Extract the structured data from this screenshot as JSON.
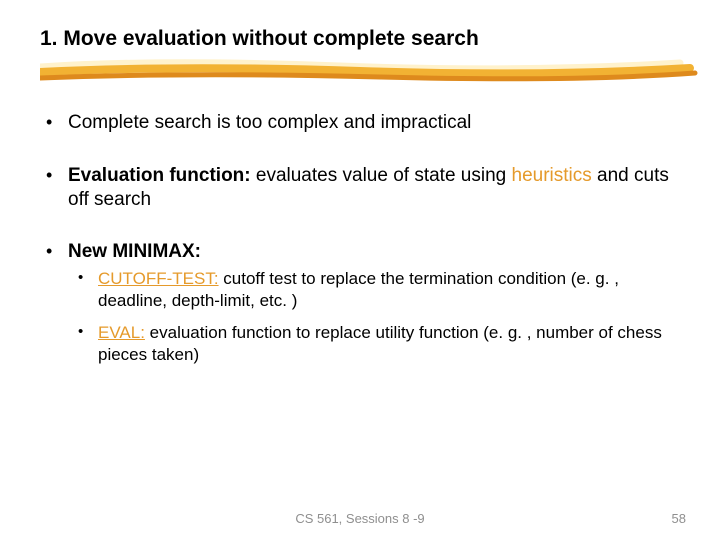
{
  "title": "1. Move evaluation without complete search",
  "bullets": {
    "b1": "Complete search is too complex and impractical",
    "b2_lead": "Evaluation function:",
    "b2_mid": " evaluates value of state using ",
    "b2_heur": "heuristics",
    "b2_tail": " and cuts off search",
    "b3": "New MINIMAX:",
    "s1_lead": "CUTOFF-TEST:",
    "s1_rest": " cutoff test to replace the termination condition (e. g. , deadline, depth-limit, etc. )",
    "s2_lead": "EVAL:",
    "s2_rest": " evaluation function to replace utility function (e. g. , number of chess pieces taken)"
  },
  "footer": {
    "center": "CS 561,  Sessions 8 -9",
    "page": "58"
  },
  "stripe": {
    "y1": "#fff2cc",
    "y2": "#f2b233",
    "y3": "#de8a1d"
  }
}
